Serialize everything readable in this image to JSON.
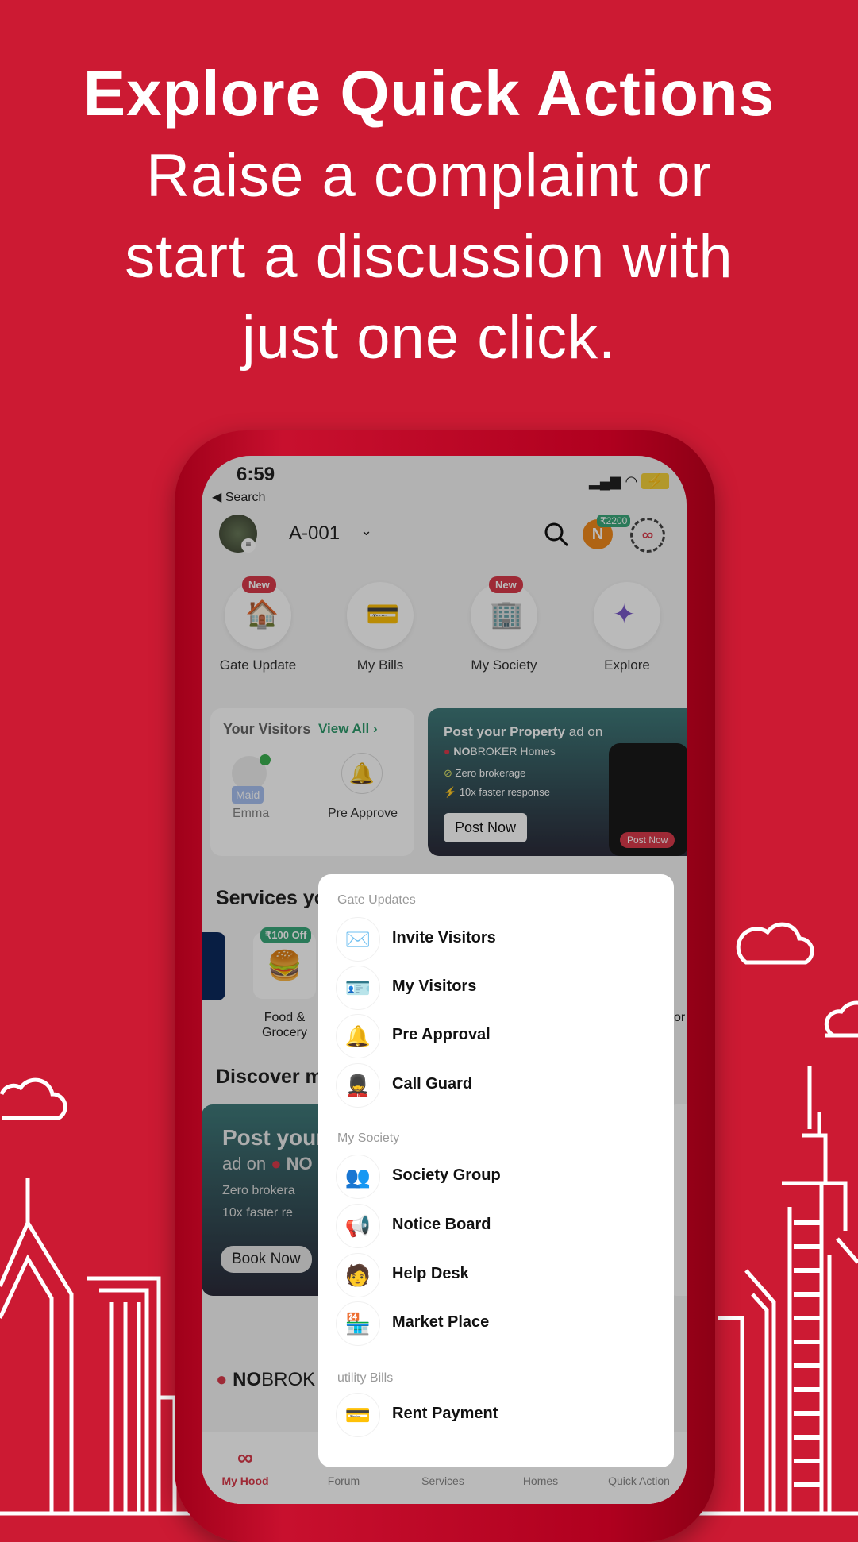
{
  "headline": {
    "title": "Explore Quick Actions",
    "lines": [
      "Raise a complaint or",
      "start a discussion with",
      "just one click."
    ]
  },
  "colors": {
    "background": "#cc1a33",
    "accent": "#d93a4a",
    "green": "#2e9a6b"
  },
  "status_bar": {
    "time": "6:59",
    "back_label": "◀ Search"
  },
  "header": {
    "flat": "A-001",
    "coin_badge": "₹2200",
    "coin_letter": "N"
  },
  "quick_tiles": [
    {
      "label": "Gate Update",
      "badge": "New",
      "icon": "house-icon"
    },
    {
      "label": "My Bills",
      "badge": "",
      "icon": "bills-icon"
    },
    {
      "label": "My Society",
      "badge": "New",
      "icon": "building-icon"
    },
    {
      "label": "Explore",
      "badge": "",
      "icon": "compass-icon"
    }
  ],
  "visitors": {
    "title": "Your Visitors",
    "view_all": "View All ›",
    "visitor_name": "Emma",
    "visitor_tag": "Maid",
    "pre_approve": "Pre Approve"
  },
  "ad": {
    "title_bold": "Post your Property",
    "title_rest": " ad on",
    "brand_bold": "NO",
    "brand_rest": "BROKER Homes",
    "bullet1": "Zero brokerage",
    "bullet2": "10x faster response",
    "button": "Post Now",
    "phone_button": "Post Now"
  },
  "services": {
    "title": "Services yo",
    "badge": "₹100 Off",
    "tile_label_1": "Food &",
    "tile_label_2": "Grocery",
    "cut_label": "or"
  },
  "discover": {
    "title": "Discover m",
    "card_title": "Post your",
    "card_line2": "ad on",
    "card_brand": "NO",
    "bullet1": "Zero brokera",
    "bullet2": "10x faster re",
    "button": "Book Now"
  },
  "brand_footer": {
    "bold": "NO",
    "rest": "BROK"
  },
  "popup": {
    "sections": [
      {
        "title": "Gate Updates",
        "items": [
          {
            "label": "Invite Visitors",
            "icon": "envelope-icon"
          },
          {
            "label": "My Visitors",
            "icon": "id-card-icon"
          },
          {
            "label": "Pre Approval",
            "icon": "bell-icon"
          },
          {
            "label": "Call Guard",
            "icon": "guard-icon"
          }
        ]
      },
      {
        "title": "My Society",
        "items": [
          {
            "label": "Society Group",
            "icon": "group-icon"
          },
          {
            "label": "Notice Board",
            "icon": "megaphone-icon"
          },
          {
            "label": "Help Desk",
            "icon": "support-agent-icon"
          },
          {
            "label": "Market Place",
            "icon": "shop-icon"
          }
        ]
      },
      {
        "title": "utility Bills",
        "items": [
          {
            "label": "Rent Payment",
            "icon": "card-payment-icon"
          }
        ]
      }
    ]
  },
  "bottom_nav": [
    {
      "label": "My Hood",
      "active": true
    },
    {
      "label": "Forum"
    },
    {
      "label": "Services"
    },
    {
      "label": "Homes"
    },
    {
      "label": "Quick Action"
    }
  ]
}
